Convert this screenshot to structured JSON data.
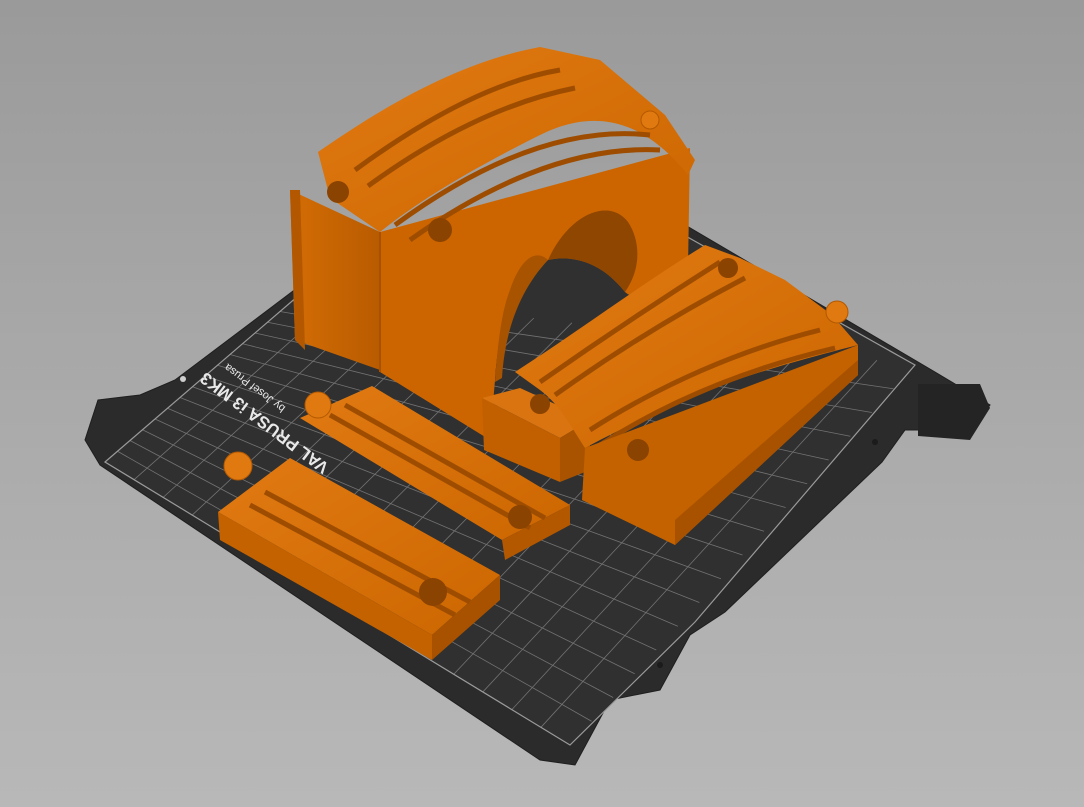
{
  "viewport": {
    "background_top": "#9a9a9a",
    "background_bottom": "#b8b8b8"
  },
  "print_bed": {
    "plate_color": "#2c2c2c",
    "grid_color": "#7a7a7a",
    "logo_line1": "VAL PRUSA i3 MK3",
    "logo_line2": "by Josef Prusa"
  },
  "models": {
    "color": "#d06a00",
    "shade_color": "#9e4f00",
    "highlight_color": "#e07a10",
    "items": [
      {
        "name": "tunnel-arch-model"
      },
      {
        "name": "curved-ramp-track-model"
      },
      {
        "name": "straight-track-model-back"
      },
      {
        "name": "straight-track-model-front"
      },
      {
        "name": "track-riser-block-model"
      }
    ]
  }
}
